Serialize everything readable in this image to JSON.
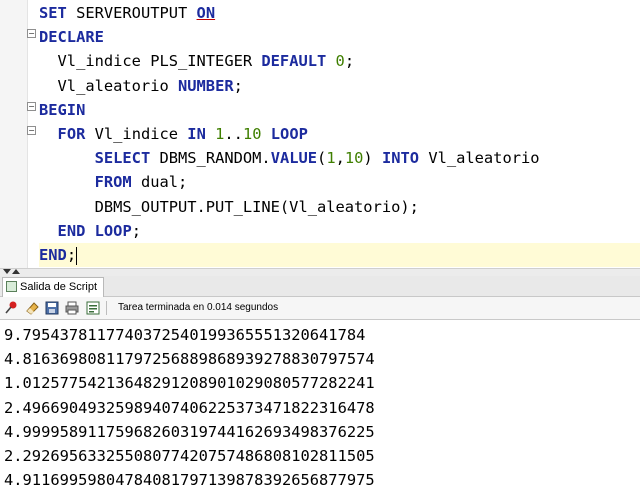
{
  "editor": {
    "lines": [
      {
        "tokens": [
          {
            "t": "SET",
            "c": "kw"
          },
          {
            "t": " SERVEROUTPUT "
          },
          {
            "t": "ON",
            "c": "kw und"
          }
        ]
      },
      {
        "tokens": [
          {
            "t": "DECLARE",
            "c": "kw"
          }
        ]
      },
      {
        "tokens": [
          {
            "t": "  Vl_indice PLS_INTEGER "
          },
          {
            "t": "DEFAULT",
            "c": "kw"
          },
          {
            "t": " "
          },
          {
            "t": "0",
            "c": "num"
          },
          {
            "t": ";"
          }
        ]
      },
      {
        "tokens": [
          {
            "t": "  Vl_aleatorio "
          },
          {
            "t": "NUMBER",
            "c": "kw"
          },
          {
            "t": ";"
          }
        ]
      },
      {
        "tokens": [
          {
            "t": "BEGIN",
            "c": "kw"
          }
        ]
      },
      {
        "tokens": [
          {
            "t": "  "
          },
          {
            "t": "FOR",
            "c": "kw"
          },
          {
            "t": " Vl_indice "
          },
          {
            "t": "IN",
            "c": "kw"
          },
          {
            "t": " "
          },
          {
            "t": "1",
            "c": "num"
          },
          {
            "t": ".."
          },
          {
            "t": "10",
            "c": "num"
          },
          {
            "t": " "
          },
          {
            "t": "LOOP",
            "c": "kw"
          }
        ]
      },
      {
        "tokens": [
          {
            "t": "      "
          },
          {
            "t": "SELECT",
            "c": "kw"
          },
          {
            "t": " DBMS_RANDOM."
          },
          {
            "t": "VALUE",
            "c": "kw"
          },
          {
            "t": "("
          },
          {
            "t": "1",
            "c": "num"
          },
          {
            "t": ","
          },
          {
            "t": "10",
            "c": "num"
          },
          {
            "t": ") "
          },
          {
            "t": "INTO",
            "c": "kw"
          },
          {
            "t": " Vl_aleatorio"
          }
        ]
      },
      {
        "tokens": [
          {
            "t": "      "
          },
          {
            "t": "FROM",
            "c": "kw"
          },
          {
            "t": " dual;"
          }
        ]
      },
      {
        "tokens": [
          {
            "t": "      DBMS_OUTPUT.PUT_LINE(Vl_aleatorio);"
          }
        ]
      },
      {
        "tokens": [
          {
            "t": "  "
          },
          {
            "t": "END",
            "c": "kw"
          },
          {
            "t": " "
          },
          {
            "t": "LOOP",
            "c": "kw"
          },
          {
            "t": ";"
          }
        ]
      },
      {
        "tokens": [
          {
            "t": "END",
            "c": "kw"
          },
          {
            "t": ";"
          }
        ],
        "current": true
      }
    ]
  },
  "tabs": {
    "script_output": "Salida de Script"
  },
  "toolbar": {
    "status": "Tarea terminada en 0.014 segundos",
    "icons": [
      "pin-icon",
      "eraser-icon",
      "save-icon",
      "print-icon",
      "spool-icon"
    ]
  },
  "output": {
    "lines": [
      "9.79543781177403725401993655513206417​84",
      "4.81636980811797256889868939278830797574",
      "1.01257754213648291208901029080577282241",
      "2.49669049325989407406225373471822316478",
      "4.99995891175968260319744162693498376225",
      "2.29269563325508077420757486808102811505",
      "4.91169959804784081797139878392656877975"
    ]
  },
  "colors": {
    "keyword": "#1c2b9e",
    "number": "#3f7f00",
    "current_line": "#fffbd6"
  }
}
